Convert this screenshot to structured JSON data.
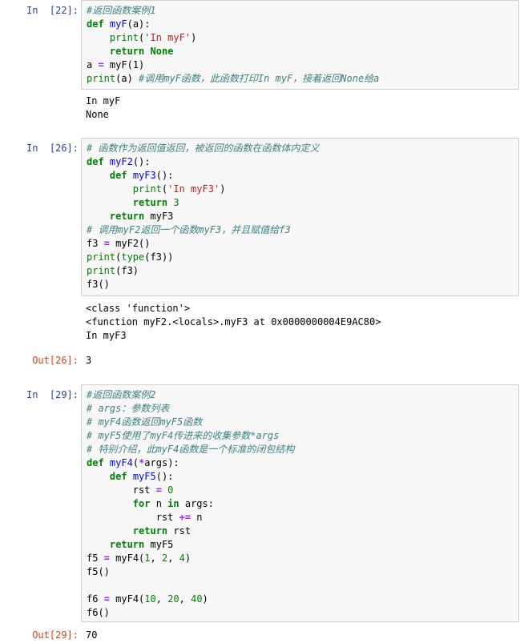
{
  "cells": [
    {
      "prompt": "In  [22]:",
      "code": [
        [
          [
            "cm",
            "#返回函数案例1"
          ]
        ],
        [
          [
            "kw",
            "def"
          ],
          [
            "pl",
            " "
          ],
          [
            "fn",
            "myF"
          ],
          [
            "pl",
            "(a):"
          ]
        ],
        [
          [
            "pl",
            "    "
          ],
          [
            "bi",
            "print"
          ],
          [
            "pl",
            "("
          ],
          [
            "str",
            "'In myF'"
          ],
          [
            "pl",
            ")"
          ]
        ],
        [
          [
            "pl",
            "    "
          ],
          [
            "kw",
            "return"
          ],
          [
            "pl",
            " "
          ],
          [
            "kw",
            "None"
          ]
        ],
        [
          [
            "pl",
            "a "
          ],
          [
            "op",
            "="
          ],
          [
            "pl",
            " myF(1)"
          ]
        ],
        [
          [
            "bi",
            "print"
          ],
          [
            "pl",
            "(a) "
          ],
          [
            "cm",
            "#调用myF函数，此函数打印In myF，接着返回None给a"
          ]
        ]
      ],
      "output": [
        "In myF",
        "None"
      ]
    },
    {
      "prompt": "In  [26]:",
      "code": [
        [
          [
            "cm",
            "# 函数作为返回值返回，被返回的函数在函数体内定义"
          ]
        ],
        [
          [
            "kw",
            "def"
          ],
          [
            "pl",
            " "
          ],
          [
            "fn",
            "myF2"
          ],
          [
            "pl",
            "():"
          ]
        ],
        [
          [
            "pl",
            "    "
          ],
          [
            "kw",
            "def"
          ],
          [
            "pl",
            " "
          ],
          [
            "fn",
            "myF3"
          ],
          [
            "pl",
            "():"
          ]
        ],
        [
          [
            "pl",
            "        "
          ],
          [
            "bi",
            "print"
          ],
          [
            "pl",
            "("
          ],
          [
            "str",
            "'In myF3'"
          ],
          [
            "pl",
            ")"
          ]
        ],
        [
          [
            "pl",
            "        "
          ],
          [
            "kw",
            "return"
          ],
          [
            "pl",
            " "
          ],
          [
            "num",
            "3"
          ]
        ],
        [
          [
            "pl",
            "    "
          ],
          [
            "kw",
            "return"
          ],
          [
            "pl",
            " myF3"
          ]
        ],
        [
          [
            "cm",
            "# 调用myF2返回一个函数myF3，并且赋值给f3"
          ]
        ],
        [
          [
            "pl",
            "f3 "
          ],
          [
            "op",
            "="
          ],
          [
            "pl",
            " myF2()"
          ]
        ],
        [
          [
            "bi",
            "print"
          ],
          [
            "pl",
            "("
          ],
          [
            "bi",
            "type"
          ],
          [
            "pl",
            "(f3))"
          ]
        ],
        [
          [
            "bi",
            "print"
          ],
          [
            "pl",
            "(f3)"
          ]
        ],
        [
          [
            "pl",
            "f3()"
          ]
        ]
      ],
      "output": [
        "<class 'function'>",
        "<function myF2.<locals>.myF3 at 0x0000000004E9AC80>",
        "In myF3"
      ],
      "out_prompt": "Out[26]:",
      "result": "3"
    },
    {
      "prompt": "In  [29]:",
      "code": [
        [
          [
            "cm",
            "#返回函数案例2"
          ]
        ],
        [
          [
            "cm",
            "# args：参数列表"
          ]
        ],
        [
          [
            "cm",
            "# myF4函数返回myF5函数"
          ]
        ],
        [
          [
            "cm",
            "# myF5使用了myF4传进来的收集参数*args"
          ]
        ],
        [
          [
            "cm",
            "# 特别介绍，此myF4函数是一个标准的闭包结构"
          ]
        ],
        [
          [
            "kw",
            "def"
          ],
          [
            "pl",
            " "
          ],
          [
            "fn",
            "myF4"
          ],
          [
            "pl",
            "("
          ],
          [
            "op",
            "*"
          ],
          [
            "pl",
            "args):"
          ]
        ],
        [
          [
            "pl",
            "    "
          ],
          [
            "kw",
            "def"
          ],
          [
            "pl",
            " "
          ],
          [
            "fn",
            "myF5"
          ],
          [
            "pl",
            "():"
          ]
        ],
        [
          [
            "pl",
            "        rst "
          ],
          [
            "op",
            "="
          ],
          [
            "pl",
            " "
          ],
          [
            "num",
            "0"
          ]
        ],
        [
          [
            "pl",
            "        "
          ],
          [
            "kw",
            "for"
          ],
          [
            "pl",
            " n "
          ],
          [
            "kw",
            "in"
          ],
          [
            "pl",
            " args:"
          ]
        ],
        [
          [
            "pl",
            "            rst "
          ],
          [
            "op",
            "+="
          ],
          [
            "pl",
            " n"
          ]
        ],
        [
          [
            "pl",
            "        "
          ],
          [
            "kw",
            "return"
          ],
          [
            "pl",
            " rst"
          ]
        ],
        [
          [
            "pl",
            "    "
          ],
          [
            "kw",
            "return"
          ],
          [
            "pl",
            " myF5"
          ]
        ],
        [
          [
            "pl",
            "f5 "
          ],
          [
            "op",
            "="
          ],
          [
            "pl",
            " myF4("
          ],
          [
            "num",
            "1"
          ],
          [
            "pl",
            ", "
          ],
          [
            "num",
            "2"
          ],
          [
            "pl",
            ", "
          ],
          [
            "num",
            "4"
          ],
          [
            "pl",
            ")"
          ]
        ],
        [
          [
            "pl",
            "f5()"
          ]
        ],
        [
          [
            "pl",
            ""
          ]
        ],
        [
          [
            "pl",
            "f6 "
          ],
          [
            "op",
            "="
          ],
          [
            "pl",
            " myF4("
          ],
          [
            "num",
            "10"
          ],
          [
            "pl",
            ", "
          ],
          [
            "num",
            "20"
          ],
          [
            "pl",
            ", "
          ],
          [
            "num",
            "40"
          ],
          [
            "pl",
            ")"
          ]
        ],
        [
          [
            "pl",
            "f6()"
          ]
        ]
      ],
      "out_prompt": "Out[29]:",
      "result": "70"
    }
  ]
}
